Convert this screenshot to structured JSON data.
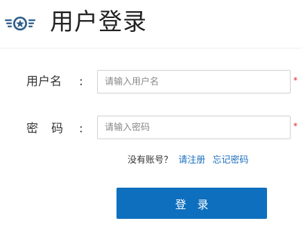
{
  "header": {
    "title": "用户登录",
    "logo_icon": "winged-star-badge-icon",
    "logo_color": "#2f5f8a"
  },
  "form": {
    "username": {
      "label": "用户名",
      "colon": ":",
      "placeholder": "请输入用户名",
      "value": "",
      "required_mark": "*"
    },
    "password": {
      "label_char1": "密",
      "label_char2": "码",
      "colon": ":",
      "placeholder": "请输入密码",
      "value": "",
      "required_mark": "*"
    },
    "no_account_text": "没有账号？",
    "register_link": "请注册",
    "forgot_link": "忘记密码",
    "login_button": "登录"
  },
  "colors": {
    "primary": "#0d6fbe",
    "link": "#1a6fbd",
    "required": "#e02020"
  }
}
